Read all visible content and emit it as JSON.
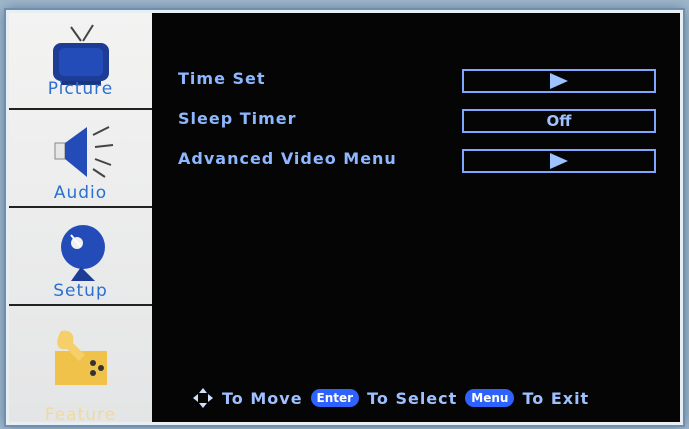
{
  "sidebar": {
    "items": [
      {
        "label": "Picture",
        "icon": "tv-icon",
        "active": false
      },
      {
        "label": "Audio",
        "icon": "speaker-icon",
        "active": false
      },
      {
        "label": "Setup",
        "icon": "satellite-dish-icon",
        "active": false
      },
      {
        "label": "Feature",
        "icon": "tools-icon",
        "active": true
      }
    ]
  },
  "menu": {
    "rows": [
      {
        "label": "Time Set",
        "value": "",
        "arrow": true
      },
      {
        "label": "Sleep Timer",
        "value": "Off",
        "arrow": false
      },
      {
        "label": "Advanced Video Menu",
        "value": "",
        "arrow": true
      }
    ]
  },
  "footer": {
    "move_text": "To Move",
    "enter_key": "Enter",
    "select_text": "To Select",
    "menu_key": "Menu",
    "exit_text": "To Exit"
  },
  "colors": {
    "accent_blue": "#8db7ff",
    "pill_blue": "#2d62ff",
    "sidebar_bg": "#f3f3f2",
    "active_label": "#f0d9a1"
  }
}
